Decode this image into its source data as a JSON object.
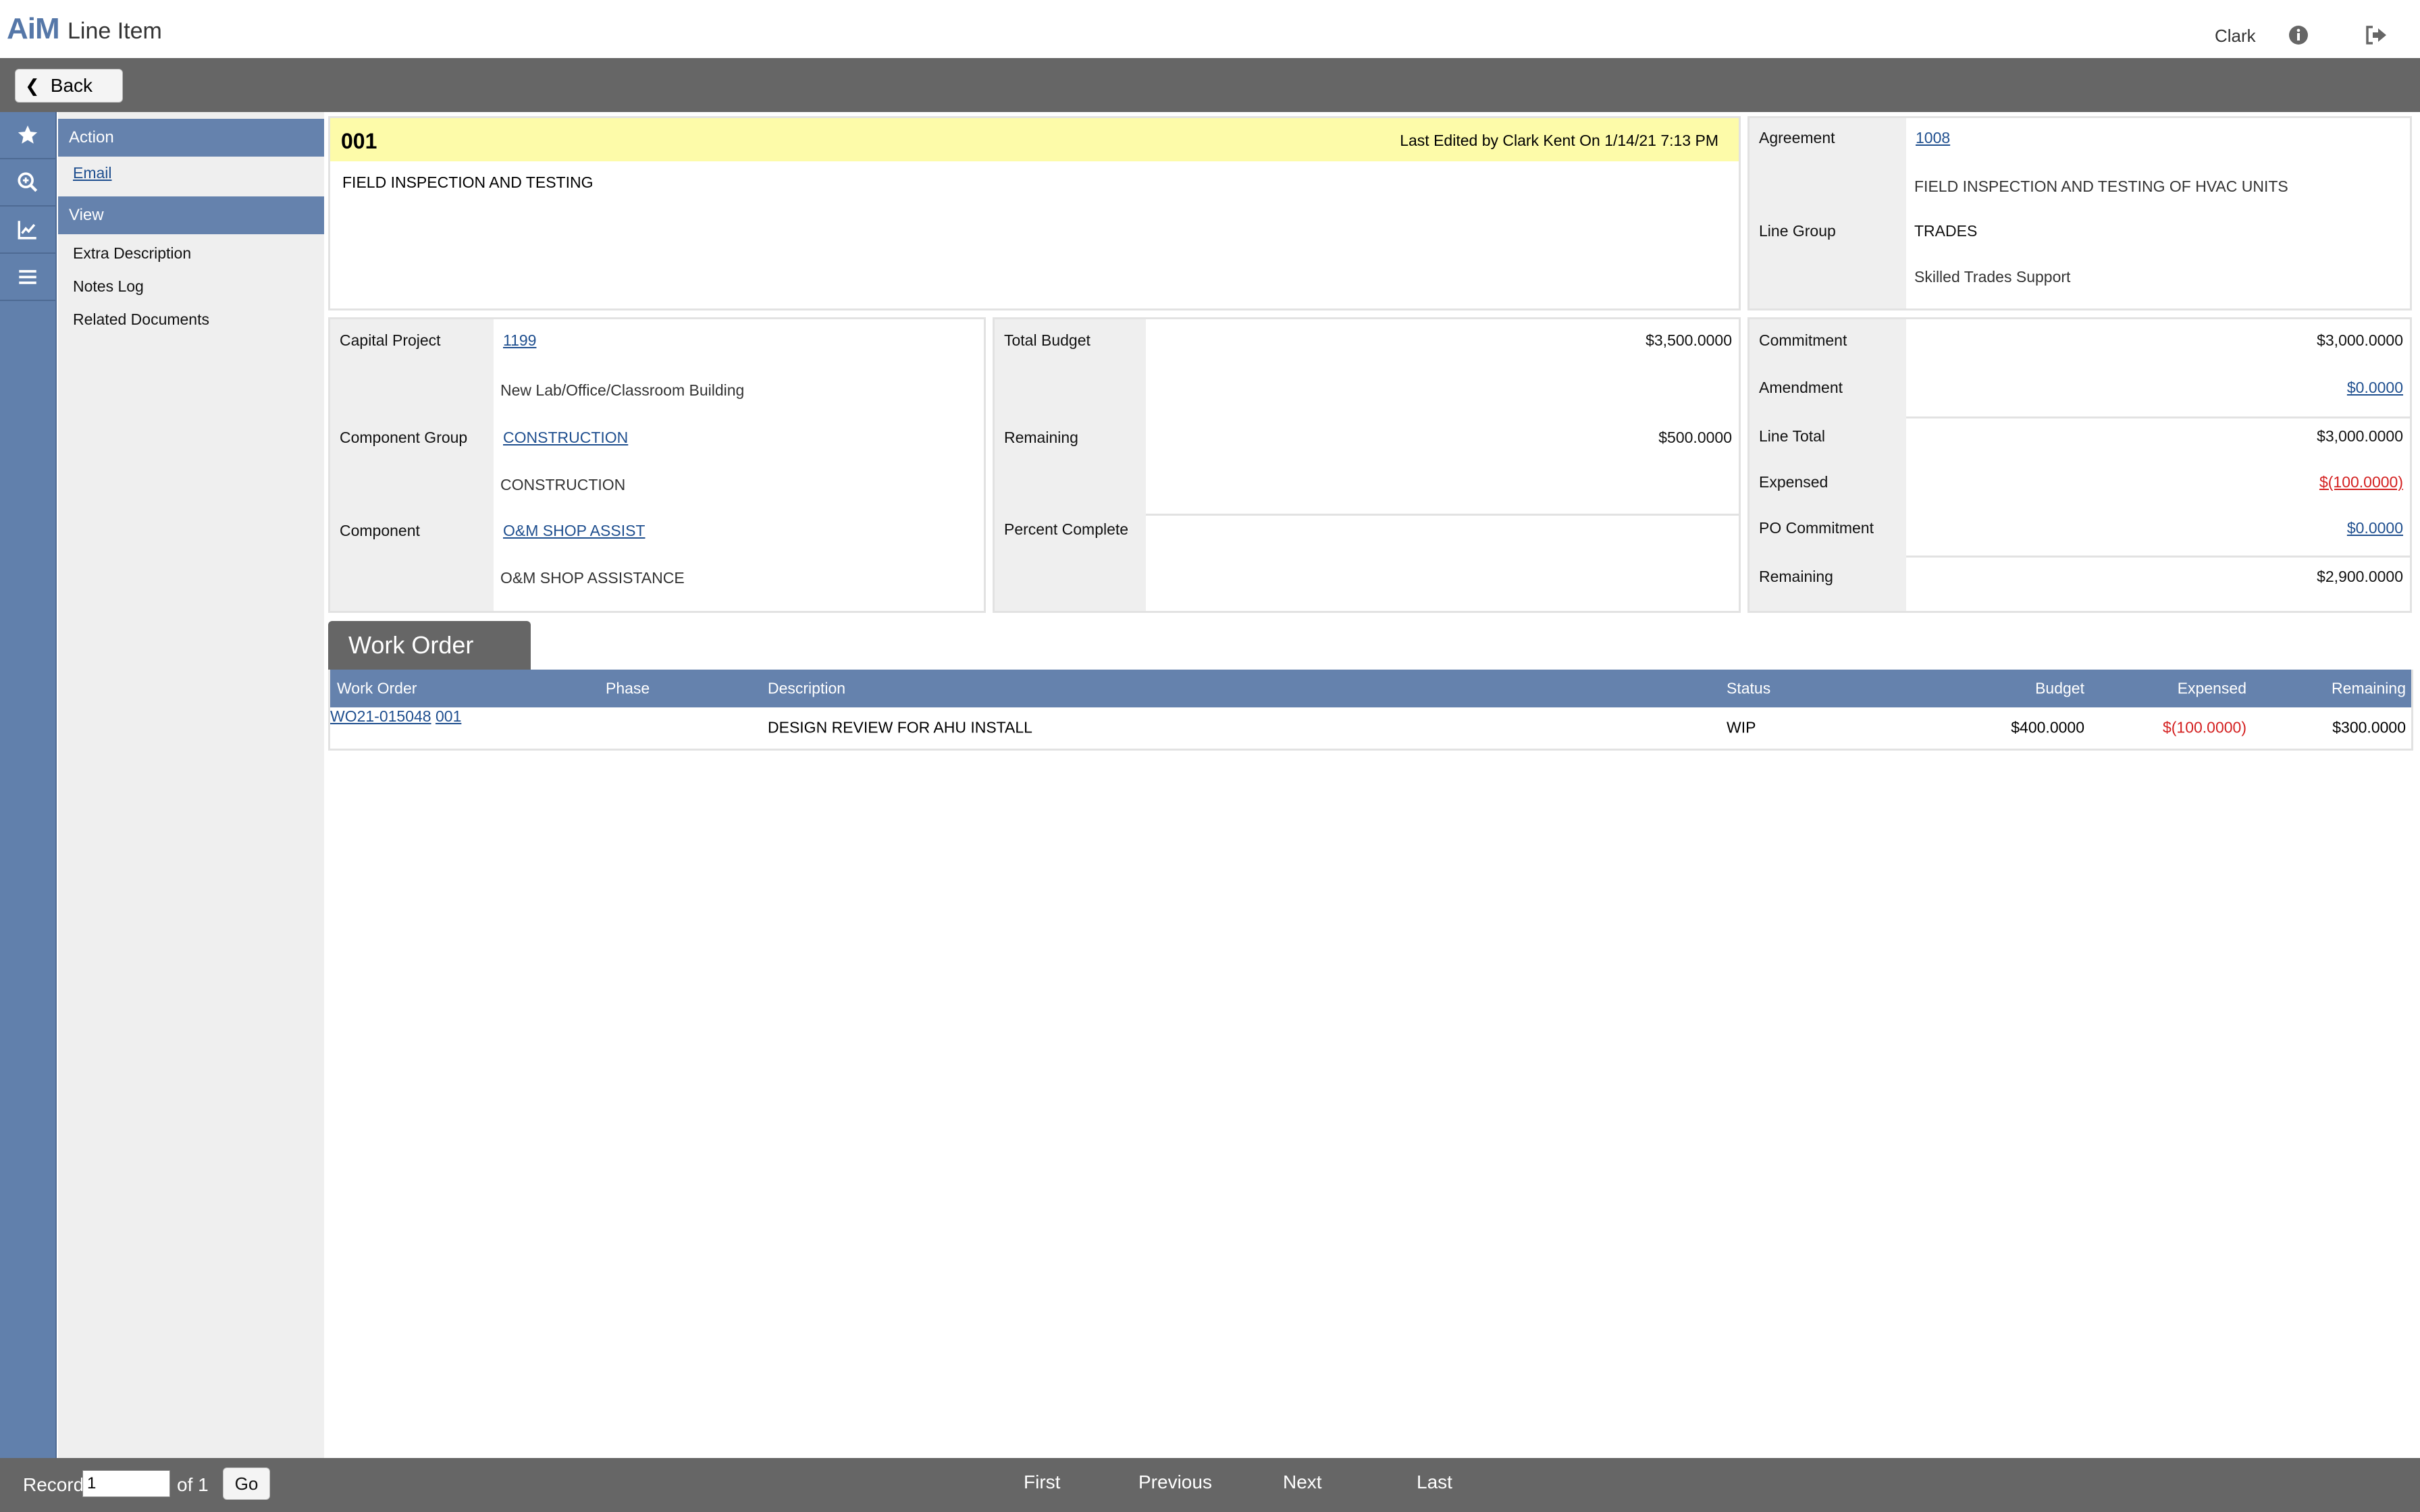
{
  "header": {
    "logo": "AiM",
    "title": "Line Item",
    "user": "Clark"
  },
  "toolbar": {
    "back_label": "Back"
  },
  "rail": {
    "icons": [
      "star-icon",
      "zoom-search-icon",
      "chart-icon",
      "menu-icon"
    ]
  },
  "nav": {
    "action_title": "Action",
    "action_items": [
      "Email"
    ],
    "view_title": "View",
    "view_items": [
      "Extra Description",
      "Notes Log",
      "Related Documents"
    ]
  },
  "main": {
    "record": "001",
    "last_edited": "Last Edited by Clark Kent On 1/14/21 7:13 PM",
    "description": "FIELD INSPECTION AND TESTING"
  },
  "agreement_panel": {
    "agreement_label": "Agreement",
    "agreement_value": "1008",
    "agreement_desc": "FIELD INSPECTION AND TESTING OF HVAC UNITS",
    "line_group_label": "Line Group",
    "line_group_value": "TRADES",
    "line_group_desc": "Skilled Trades Support"
  },
  "project_panel": {
    "capital_project_label": "Capital Project",
    "capital_project_value": "1199",
    "capital_project_desc": "New Lab/Office/Classroom Building",
    "component_group_label": "Component Group",
    "component_group_value": "CONSTRUCTION",
    "component_group_desc": "CONSTRUCTION",
    "component_label": "Component",
    "component_value": "O&M SHOP ASSIST",
    "component_desc": "O&M SHOP ASSISTANCE"
  },
  "budget_panel": {
    "total_budget_label": "Total Budget",
    "total_budget_value": "$3,500.0000",
    "remaining_label": "Remaining",
    "remaining_value": "$500.0000",
    "percent_complete_label": "Percent Complete",
    "percent_complete_value": ""
  },
  "commitment_panel": {
    "commitment_label": "Commitment",
    "commitment_value": "$3,000.0000",
    "amendment_label": "Amendment",
    "amendment_value": "$0.0000",
    "line_total_label": "Line Total",
    "line_total_value": "$3,000.0000",
    "expensed_label": "Expensed",
    "expensed_value": "$(100.0000)",
    "po_commitment_label": "PO Commitment",
    "po_commitment_value": "$0.0000",
    "remaining_label": "Remaining",
    "remaining_value": "$2,900.0000"
  },
  "work_order": {
    "tab_label": "Work Order",
    "columns": [
      "Work Order",
      "Phase",
      "Description",
      "Status",
      "Budget",
      "Expensed",
      "Remaining"
    ],
    "rows": [
      {
        "work_order": "WO21-015048",
        "phase": "001",
        "description": "DESIGN REVIEW FOR AHU INSTALL",
        "status": "WIP",
        "budget": "$400.0000",
        "expensed": "$(100.0000)",
        "remaining": "$300.0000"
      }
    ]
  },
  "footer": {
    "record_label": "Record",
    "record_value": "1",
    "of_total": "of 1",
    "go_label": "Go",
    "first": "First",
    "previous": "Previous",
    "next": "Next",
    "last": "Last"
  },
  "colors": {
    "accent": "#6582ad",
    "toolbar": "#666666",
    "highlight": "#fdfba9",
    "negative": "#d42020",
    "link": "#1f4f8f"
  }
}
